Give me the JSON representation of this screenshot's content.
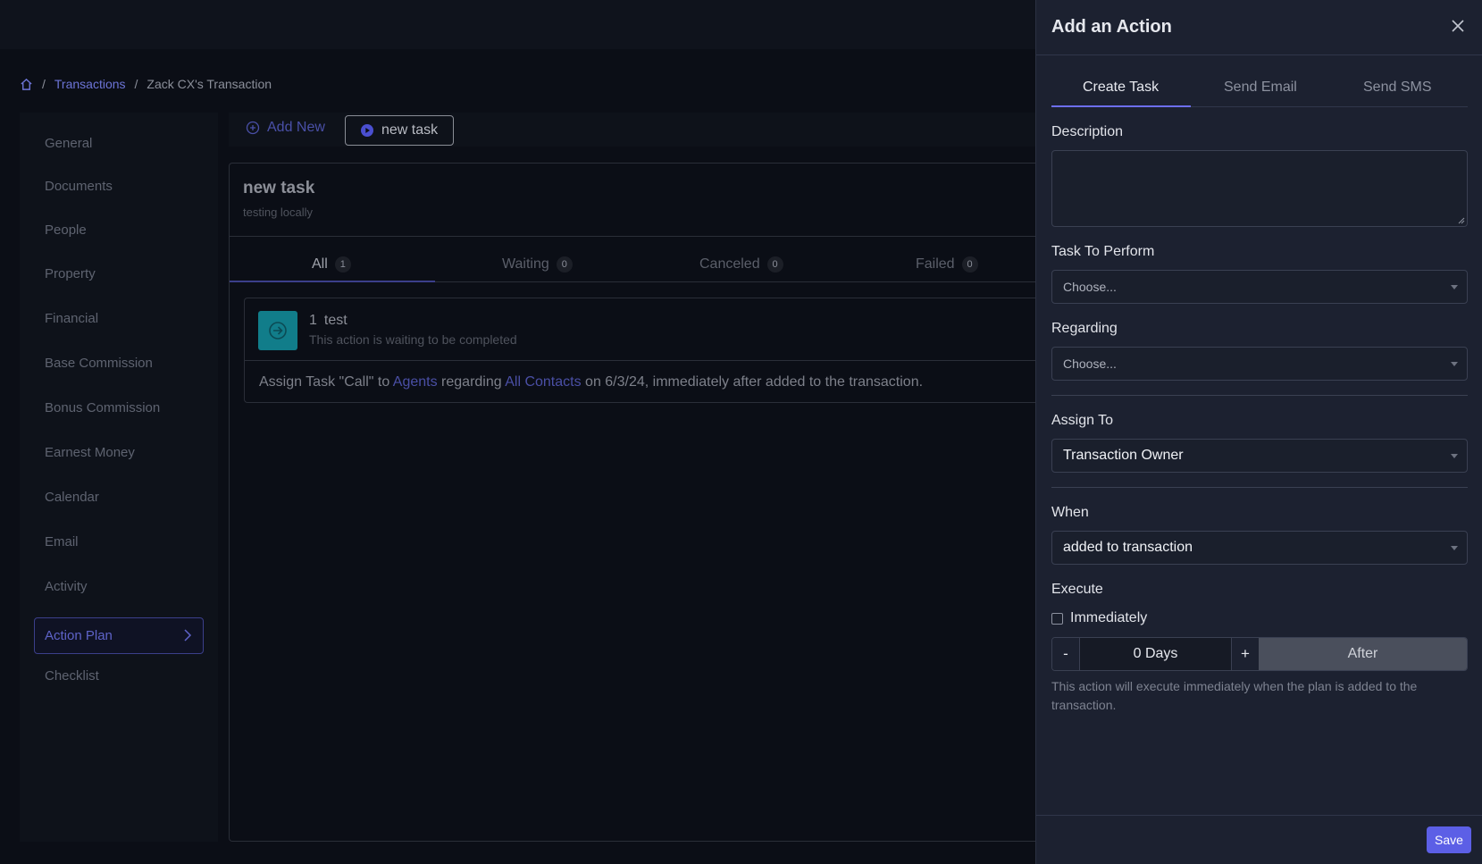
{
  "breadcrumb": {
    "sep1": "/",
    "link": "Transactions",
    "sep2": "/",
    "current": "Zack CX's Transaction"
  },
  "sidebar": {
    "items": [
      "General",
      "Documents",
      "People",
      "Property",
      "Financial",
      "Base Commission",
      "Bonus Commission",
      "Earnest Money",
      "Calendar",
      "Email",
      "Activity",
      "Action Plan",
      "Checklist"
    ],
    "active": "Action Plan"
  },
  "toolbar": {
    "add_new": "Add New",
    "new_task": "new task"
  },
  "plan": {
    "title": "new task",
    "subtitle": "testing locally",
    "tabs": [
      {
        "label": "All",
        "count": "1"
      },
      {
        "label": "Waiting",
        "count": "0"
      },
      {
        "label": "Canceled",
        "count": "0"
      },
      {
        "label": "Failed",
        "count": "0"
      }
    ],
    "action": {
      "number": "1",
      "name": "test",
      "status": "This action is waiting to be completed",
      "desc_prefix": "Assign Task  \"Call\"  to ",
      "desc_agents": "Agents",
      "desc_mid": "  regarding ",
      "desc_contacts": "All Contacts",
      "desc_suffix": "  on 6/3/24, immediately after added to the transaction."
    }
  },
  "drawer": {
    "title": "Add an Action",
    "tabs": [
      "Create Task",
      "Send Email",
      "Send SMS"
    ],
    "description_label": "Description",
    "task_label": "Task To Perform",
    "task_value": "Choose...",
    "regarding_label": "Regarding",
    "regarding_value": "Choose...",
    "assign_label": "Assign To",
    "assign_value": "Transaction Owner",
    "when_label": "When",
    "when_value": "added to transaction",
    "execute_label": "Execute",
    "immediately_label": "Immediately",
    "minus": "-",
    "days_value": "0 Days",
    "plus": "+",
    "after": "After",
    "help_text": "This action will execute immediately when the plan is added to the transaction.",
    "save": "Save"
  }
}
